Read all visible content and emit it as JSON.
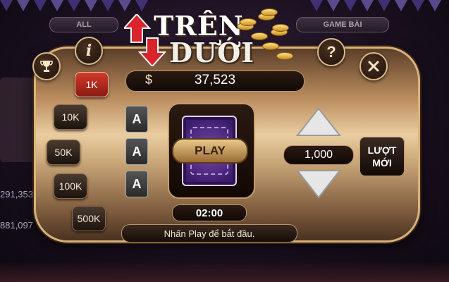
{
  "lobby": {
    "tab_all": "ALL",
    "tab_game_bai": "GAME BÀI",
    "side_values": [
      "291,353",
      "881,097"
    ]
  },
  "logo": {
    "line1": "TRÊN",
    "line2": "DƯỚI"
  },
  "balance": {
    "currency_symbol": "$",
    "amount": "37,523"
  },
  "chips": [
    {
      "label": "1K",
      "selected": true
    },
    {
      "label": "10K",
      "selected": false
    },
    {
      "label": "50K",
      "selected": false
    },
    {
      "label": "100K",
      "selected": false
    },
    {
      "label": "500K",
      "selected": false
    }
  ],
  "cards": [
    "A",
    "A",
    "A"
  ],
  "game": {
    "play_label": "PLAY",
    "timer": "02:00",
    "hint": "Nhấn Play để bắt đầu."
  },
  "bet": {
    "amount": "1,000"
  },
  "new_turn": {
    "line1": "LƯỢT",
    "line2": "MỚI"
  },
  "icons": {
    "trophy": "trophy-icon",
    "info": "info-icon",
    "help": "help-icon",
    "close": "close-icon",
    "up": "arrow-up-icon",
    "down": "arrow-down-icon"
  },
  "colors": {
    "selected_chip": "#d23a2a",
    "panel_gold": "#e9cda0",
    "logo_arrow_red": "#d8242a"
  }
}
